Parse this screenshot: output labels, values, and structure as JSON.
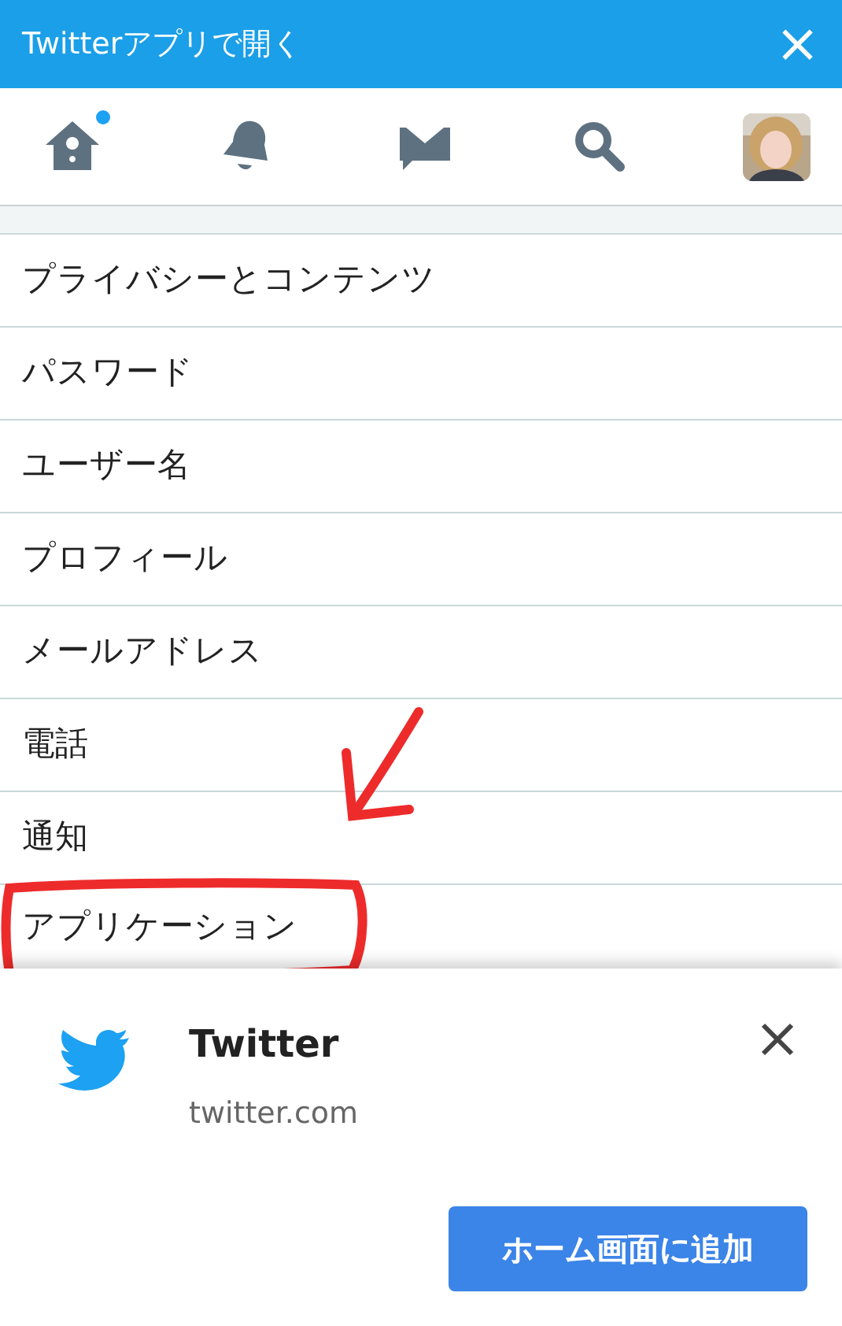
{
  "header": {
    "title": "Twitterアプリで開く",
    "close": "×"
  },
  "nav": [
    {
      "kind": "home",
      "unread": true
    },
    {
      "kind": "bell",
      "unread": false
    },
    {
      "kind": "mail",
      "unread": false
    },
    {
      "kind": "search",
      "unread": false
    },
    {
      "kind": "avatar",
      "unread": false
    }
  ],
  "settings": [
    {
      "label": "プライバシーとコンテンツ",
      "annotated": false
    },
    {
      "label": "パスワード",
      "annotated": false
    },
    {
      "label": "ユーザー名",
      "annotated": false
    },
    {
      "label": "プロフィール",
      "annotated": false
    },
    {
      "label": "メールアドレス",
      "annotated": false
    },
    {
      "label": "電話",
      "annotated": false
    },
    {
      "label": "通知",
      "annotated": false
    },
    {
      "label": "アプリケーション",
      "annotated": true
    }
  ],
  "install_banner": {
    "app_name": "Twitter",
    "domain": "twitter.com",
    "button": "ホーム画面に追加"
  }
}
